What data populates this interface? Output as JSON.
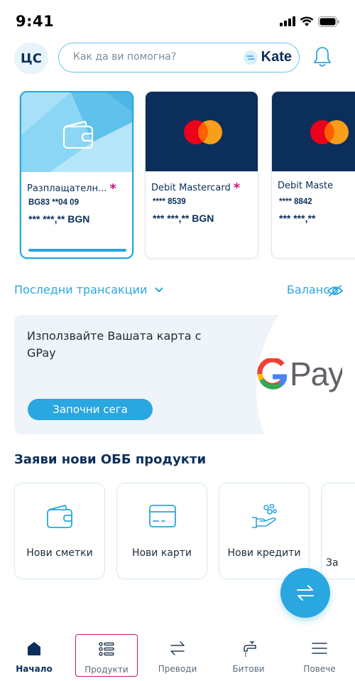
{
  "status": {
    "time": "9:41"
  },
  "header": {
    "avatar_initials": "ЦС",
    "search_placeholder": "Как да ви помогна?",
    "assistant_name": "Kate"
  },
  "cards": [
    {
      "name": "Разплащателн...",
      "number": "BG83 **04 09",
      "balance": "*** ***,** BGN",
      "selected": true
    },
    {
      "name": "Debit Mastercard",
      "number": "**** 8539",
      "balance": "*** ***,** BGN",
      "selected": false
    },
    {
      "name": "Debit Maste",
      "number": "**** 8842",
      "balance": "*** ***,**",
      "selected": false
    }
  ],
  "links": {
    "recent_transactions": "Последни трансакции",
    "balance": "Баланс"
  },
  "promo": {
    "text": "Използвайте Вашата карта с GPay",
    "button": "Започни сега",
    "brand": "Pay"
  },
  "products": {
    "title": "Заяви нови ОББ продукти",
    "items": [
      {
        "label": "Нови сметки",
        "icon": "wallet-icon"
      },
      {
        "label": "Нови карти",
        "icon": "credit-card-icon"
      },
      {
        "label": "Нови кредити",
        "icon": "coins-hand-icon"
      },
      {
        "label": "За",
        "icon": "more-icon"
      }
    ]
  },
  "nav": {
    "items": [
      {
        "label": "Начало",
        "icon": "home-icon",
        "active": true
      },
      {
        "label": "Продукти",
        "icon": "list-icon",
        "active": false
      },
      {
        "label": "Преводи",
        "icon": "transfer-icon",
        "active": false
      },
      {
        "label": "Битови",
        "icon": "faucet-icon",
        "active": false
      },
      {
        "label": "Повече",
        "icon": "menu-icon",
        "active": false
      }
    ]
  },
  "colors": {
    "accent": "#2aa6e0",
    "navy": "#0b2e5a",
    "magenta": "#c0187a"
  }
}
